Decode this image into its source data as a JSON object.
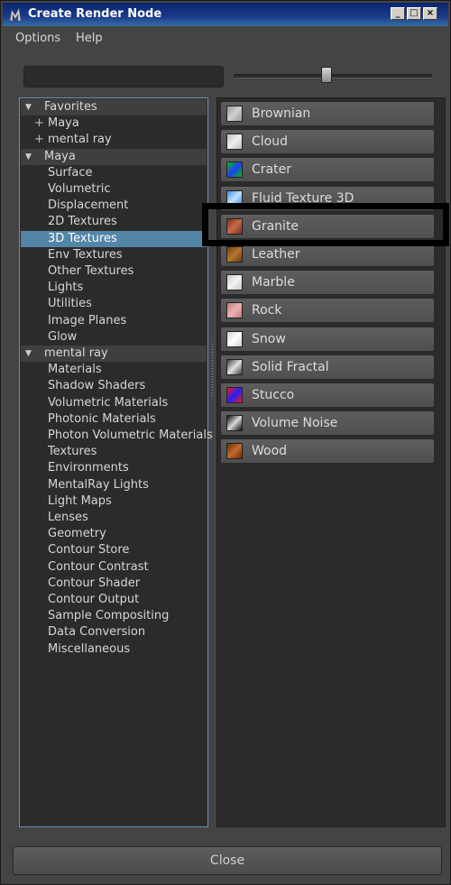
{
  "window": {
    "title": "Create Render Node"
  },
  "menu": [
    "Options",
    "Help"
  ],
  "search": {
    "value": ""
  },
  "slider": {
    "position": 0.47
  },
  "tree": [
    {
      "label": "Favorites",
      "kind": "header"
    },
    {
      "label": "Maya",
      "kind": "fav"
    },
    {
      "label": "mental ray",
      "kind": "fav"
    },
    {
      "label": "Maya",
      "kind": "header"
    },
    {
      "label": "Surface",
      "kind": "item"
    },
    {
      "label": "Volumetric",
      "kind": "item"
    },
    {
      "label": "Displacement",
      "kind": "item"
    },
    {
      "label": "2D Textures",
      "kind": "item"
    },
    {
      "label": "3D Textures",
      "kind": "item",
      "selected": true
    },
    {
      "label": "Env Textures",
      "kind": "item"
    },
    {
      "label": "Other Textures",
      "kind": "item"
    },
    {
      "label": "Lights",
      "kind": "item"
    },
    {
      "label": "Utilities",
      "kind": "item"
    },
    {
      "label": "Image Planes",
      "kind": "item"
    },
    {
      "label": "Glow",
      "kind": "item"
    },
    {
      "label": "mental ray",
      "kind": "header"
    },
    {
      "label": "Materials",
      "kind": "item"
    },
    {
      "label": "Shadow Shaders",
      "kind": "item"
    },
    {
      "label": "Volumetric Materials",
      "kind": "item"
    },
    {
      "label": "Photonic Materials",
      "kind": "item"
    },
    {
      "label": "Photon Volumetric Materials",
      "kind": "item"
    },
    {
      "label": "Textures",
      "kind": "item"
    },
    {
      "label": "Environments",
      "kind": "item"
    },
    {
      "label": "MentalRay Lights",
      "kind": "item"
    },
    {
      "label": "Light Maps",
      "kind": "item"
    },
    {
      "label": "Lenses",
      "kind": "item"
    },
    {
      "label": "Geometry",
      "kind": "item"
    },
    {
      "label": "Contour Store",
      "kind": "item"
    },
    {
      "label": "Contour Contrast",
      "kind": "item"
    },
    {
      "label": "Contour Shader",
      "kind": "item"
    },
    {
      "label": "Contour Output",
      "kind": "item"
    },
    {
      "label": "Sample Compositing",
      "kind": "item"
    },
    {
      "label": "Data Conversion",
      "kind": "item"
    },
    {
      "label": "Miscellaneous",
      "kind": "item"
    }
  ],
  "nodes": [
    {
      "label": "Brownian",
      "icon": "brownian-swatch-icon",
      "colors": [
        "#9a9a9a",
        "#d0d0d0"
      ]
    },
    {
      "label": "Cloud",
      "icon": "cloud-swatch-icon",
      "colors": [
        "#bdbdbd",
        "#efefef"
      ]
    },
    {
      "label": "Crater",
      "icon": "crater-swatch-icon",
      "colors": [
        "#00c000",
        "#1e3cff"
      ]
    },
    {
      "label": "Fluid Texture 3D",
      "icon": "fluid-texture-3d-swatch-icon",
      "colors": [
        "#3c8ee0",
        "#bfe2ff"
      ]
    },
    {
      "label": "Granite",
      "icon": "granite-swatch-icon",
      "colors": [
        "#7a2f1c",
        "#c86a4a"
      ]
    },
    {
      "label": "Leather",
      "icon": "leather-swatch-icon",
      "colors": [
        "#6e3b16",
        "#b8762e"
      ]
    },
    {
      "label": "Marble",
      "icon": "marble-swatch-icon",
      "colors": [
        "#c8c8c8",
        "#f4f4f4"
      ]
    },
    {
      "label": "Rock",
      "icon": "rock-swatch-icon",
      "colors": [
        "#c47a7a",
        "#ecb2b2"
      ]
    },
    {
      "label": "Snow",
      "icon": "snow-swatch-icon",
      "colors": [
        "#cfcfcf",
        "#ffffff"
      ]
    },
    {
      "label": "Solid Fractal",
      "icon": "solid-fractal-swatch-icon",
      "colors": [
        "#3a3a3a",
        "#e2e2e2"
      ]
    },
    {
      "label": "Stucco",
      "icon": "stucco-swatch-icon",
      "colors": [
        "#ff1010",
        "#2020ff"
      ]
    },
    {
      "label": "Volume Noise",
      "icon": "volume-noise-swatch-icon",
      "colors": [
        "#0a0a0a",
        "#d8d8d8"
      ]
    },
    {
      "label": "Wood",
      "icon": "wood-swatch-icon",
      "colors": [
        "#6a2a08",
        "#c46a2a"
      ]
    }
  ],
  "footer": {
    "close_label": "Close"
  }
}
